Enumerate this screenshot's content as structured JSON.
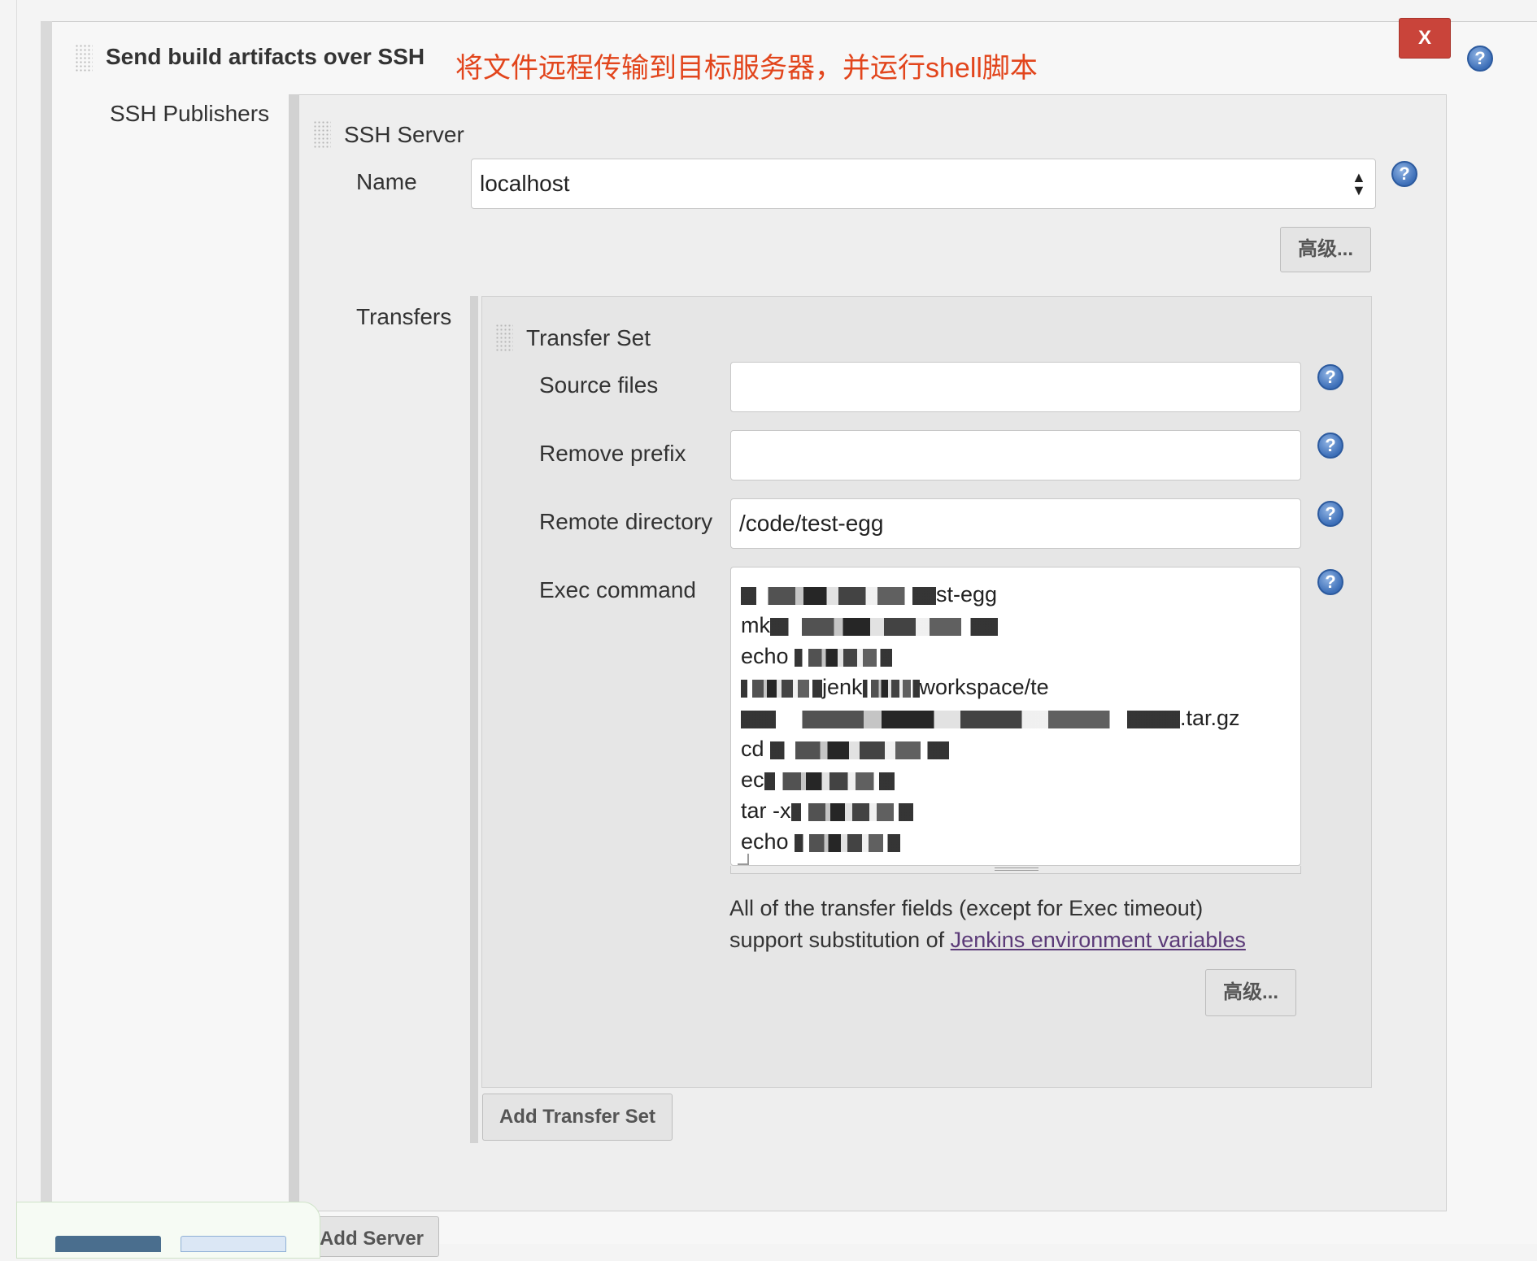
{
  "section": {
    "title": "Send build artifacts over SSH",
    "annotation": "将文件远程传输到目标服务器，并运行shell脚本",
    "close_label": "X",
    "help_glyph": "?"
  },
  "publishers": {
    "label": "SSH Publishers",
    "server": {
      "heading": "SSH Server",
      "name_label": "Name",
      "name_value": "localhost",
      "advanced_label": "高级...",
      "add_server_label": "Add Server"
    }
  },
  "transfers": {
    "label": "Transfers",
    "set_heading": "Transfer Set",
    "source_files_label": "Source files",
    "source_files_value": "",
    "remove_prefix_label": "Remove prefix",
    "remove_prefix_value": "",
    "remote_dir_label": "Remote directory",
    "remote_dir_value": "/code/test-egg",
    "exec_label": "Exec command",
    "exec_lines_visible": [
      "st-egg",
      "mk",
      "echo",
      "jenk",
      "workspace/te",
      ".tar.gz",
      "cd",
      "ec",
      "tar -x",
      "echo"
    ],
    "note_line1": "All of the transfer fields (except for Exec timeout)",
    "note_line2": "support substitution of ",
    "note_link": "Jenkins environment variables",
    "advanced_label": "高级...",
    "add_transfer_label": "Add Transfer Set"
  },
  "colors": {
    "accent_red": "#c9443a",
    "annotation": "#e2451c",
    "link": "#5b3a78",
    "help_blue": "#3d6fb8"
  }
}
